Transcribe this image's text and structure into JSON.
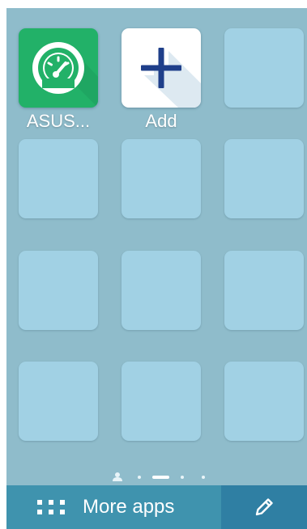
{
  "home_screen": {
    "apps": [
      {
        "label": "ASUS...",
        "icon": "speedometer-icon",
        "tile_color": "#22b168"
      },
      {
        "label": "Add",
        "icon": "plus-icon",
        "tile_color": "#ffffff"
      }
    ],
    "empty_slot_count": 10
  },
  "page_indicator": {
    "page_count": 5,
    "current_page": 3,
    "first_page_icon": "person-icon"
  },
  "bottom_bar": {
    "more_apps_label": "More apps",
    "more_apps_icon": "grid-dots-icon",
    "edit_icon": "pencil-icon"
  },
  "colors": {
    "background": "#8fbccb",
    "empty_slot": "#a1d1e4",
    "bottom_bar": "#3f93ae",
    "edit_button": "#2f7fa3",
    "plus": "#1f3f8a"
  }
}
